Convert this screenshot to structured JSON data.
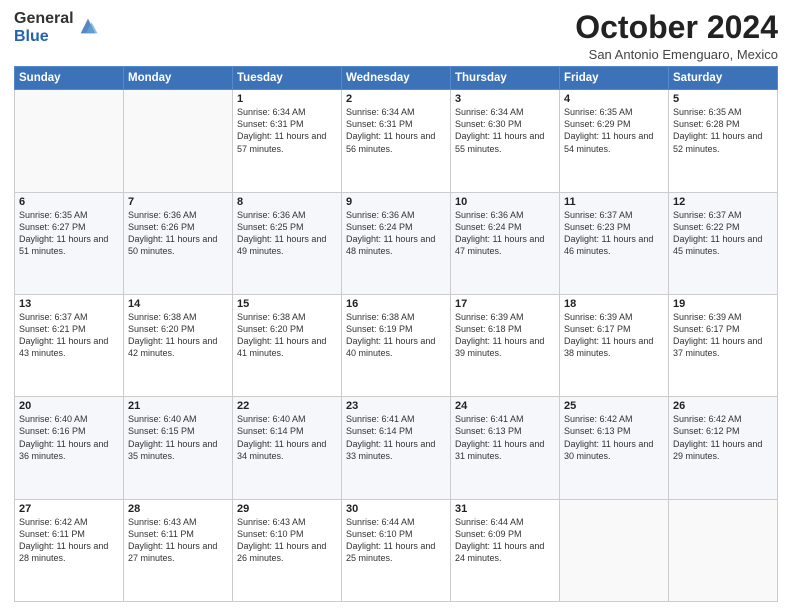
{
  "logo": {
    "general": "General",
    "blue": "Blue"
  },
  "header": {
    "month": "October 2024",
    "location": "San Antonio Emenguaro, Mexico"
  },
  "weekdays": [
    "Sunday",
    "Monday",
    "Tuesday",
    "Wednesday",
    "Thursday",
    "Friday",
    "Saturday"
  ],
  "weeks": [
    [
      {
        "day": "",
        "info": ""
      },
      {
        "day": "",
        "info": ""
      },
      {
        "day": "1",
        "info": "Sunrise: 6:34 AM\nSunset: 6:31 PM\nDaylight: 11 hours and 57 minutes."
      },
      {
        "day": "2",
        "info": "Sunrise: 6:34 AM\nSunset: 6:31 PM\nDaylight: 11 hours and 56 minutes."
      },
      {
        "day": "3",
        "info": "Sunrise: 6:34 AM\nSunset: 6:30 PM\nDaylight: 11 hours and 55 minutes."
      },
      {
        "day": "4",
        "info": "Sunrise: 6:35 AM\nSunset: 6:29 PM\nDaylight: 11 hours and 54 minutes."
      },
      {
        "day": "5",
        "info": "Sunrise: 6:35 AM\nSunset: 6:28 PM\nDaylight: 11 hours and 52 minutes."
      }
    ],
    [
      {
        "day": "6",
        "info": "Sunrise: 6:35 AM\nSunset: 6:27 PM\nDaylight: 11 hours and 51 minutes."
      },
      {
        "day": "7",
        "info": "Sunrise: 6:36 AM\nSunset: 6:26 PM\nDaylight: 11 hours and 50 minutes."
      },
      {
        "day": "8",
        "info": "Sunrise: 6:36 AM\nSunset: 6:25 PM\nDaylight: 11 hours and 49 minutes."
      },
      {
        "day": "9",
        "info": "Sunrise: 6:36 AM\nSunset: 6:24 PM\nDaylight: 11 hours and 48 minutes."
      },
      {
        "day": "10",
        "info": "Sunrise: 6:36 AM\nSunset: 6:24 PM\nDaylight: 11 hours and 47 minutes."
      },
      {
        "day": "11",
        "info": "Sunrise: 6:37 AM\nSunset: 6:23 PM\nDaylight: 11 hours and 46 minutes."
      },
      {
        "day": "12",
        "info": "Sunrise: 6:37 AM\nSunset: 6:22 PM\nDaylight: 11 hours and 45 minutes."
      }
    ],
    [
      {
        "day": "13",
        "info": "Sunrise: 6:37 AM\nSunset: 6:21 PM\nDaylight: 11 hours and 43 minutes."
      },
      {
        "day": "14",
        "info": "Sunrise: 6:38 AM\nSunset: 6:20 PM\nDaylight: 11 hours and 42 minutes."
      },
      {
        "day": "15",
        "info": "Sunrise: 6:38 AM\nSunset: 6:20 PM\nDaylight: 11 hours and 41 minutes."
      },
      {
        "day": "16",
        "info": "Sunrise: 6:38 AM\nSunset: 6:19 PM\nDaylight: 11 hours and 40 minutes."
      },
      {
        "day": "17",
        "info": "Sunrise: 6:39 AM\nSunset: 6:18 PM\nDaylight: 11 hours and 39 minutes."
      },
      {
        "day": "18",
        "info": "Sunrise: 6:39 AM\nSunset: 6:17 PM\nDaylight: 11 hours and 38 minutes."
      },
      {
        "day": "19",
        "info": "Sunrise: 6:39 AM\nSunset: 6:17 PM\nDaylight: 11 hours and 37 minutes."
      }
    ],
    [
      {
        "day": "20",
        "info": "Sunrise: 6:40 AM\nSunset: 6:16 PM\nDaylight: 11 hours and 36 minutes."
      },
      {
        "day": "21",
        "info": "Sunrise: 6:40 AM\nSunset: 6:15 PM\nDaylight: 11 hours and 35 minutes."
      },
      {
        "day": "22",
        "info": "Sunrise: 6:40 AM\nSunset: 6:14 PM\nDaylight: 11 hours and 34 minutes."
      },
      {
        "day": "23",
        "info": "Sunrise: 6:41 AM\nSunset: 6:14 PM\nDaylight: 11 hours and 33 minutes."
      },
      {
        "day": "24",
        "info": "Sunrise: 6:41 AM\nSunset: 6:13 PM\nDaylight: 11 hours and 31 minutes."
      },
      {
        "day": "25",
        "info": "Sunrise: 6:42 AM\nSunset: 6:13 PM\nDaylight: 11 hours and 30 minutes."
      },
      {
        "day": "26",
        "info": "Sunrise: 6:42 AM\nSunset: 6:12 PM\nDaylight: 11 hours and 29 minutes."
      }
    ],
    [
      {
        "day": "27",
        "info": "Sunrise: 6:42 AM\nSunset: 6:11 PM\nDaylight: 11 hours and 28 minutes."
      },
      {
        "day": "28",
        "info": "Sunrise: 6:43 AM\nSunset: 6:11 PM\nDaylight: 11 hours and 27 minutes."
      },
      {
        "day": "29",
        "info": "Sunrise: 6:43 AM\nSunset: 6:10 PM\nDaylight: 11 hours and 26 minutes."
      },
      {
        "day": "30",
        "info": "Sunrise: 6:44 AM\nSunset: 6:10 PM\nDaylight: 11 hours and 25 minutes."
      },
      {
        "day": "31",
        "info": "Sunrise: 6:44 AM\nSunset: 6:09 PM\nDaylight: 11 hours and 24 minutes."
      },
      {
        "day": "",
        "info": ""
      },
      {
        "day": "",
        "info": ""
      }
    ]
  ]
}
